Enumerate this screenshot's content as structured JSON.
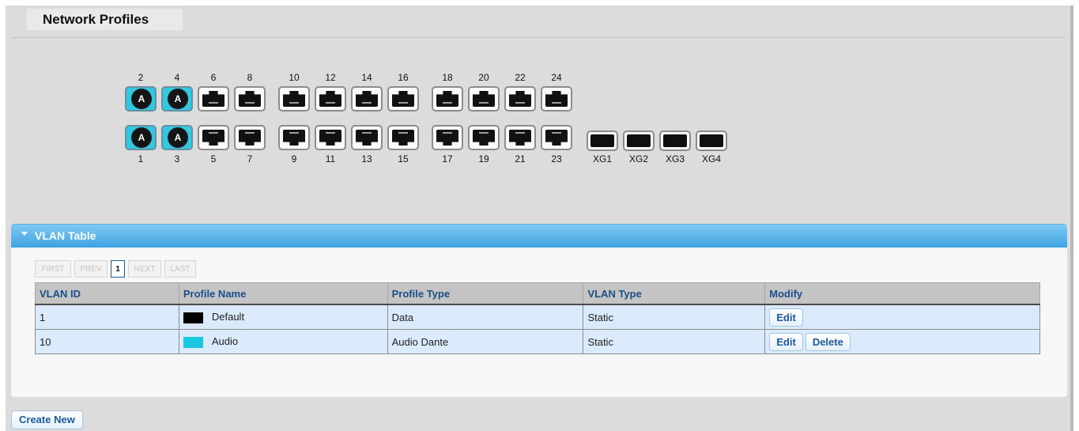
{
  "page": {
    "title": "Network Profiles"
  },
  "ports": {
    "top_labels": [
      "2",
      "4",
      "6",
      "8",
      "10",
      "12",
      "14",
      "16",
      "18",
      "20",
      "22",
      "24"
    ],
    "bottom_labels": [
      "1",
      "3",
      "5",
      "7",
      "9",
      "11",
      "13",
      "15",
      "17",
      "19",
      "21",
      "23"
    ],
    "sfp_labels": [
      "XG1",
      "XG2",
      "XG3",
      "XG4"
    ],
    "active_badge": "A",
    "active_ports": [
      "1",
      "2",
      "3",
      "4"
    ],
    "active_color": "#36c7e0"
  },
  "vlan_panel": {
    "title": "VLAN Table",
    "pager": {
      "first": "FIRST",
      "prev": "PREV",
      "current": "1",
      "next": "NEXT",
      "last": "LAST"
    },
    "columns": [
      "VLAN ID",
      "Profile Name",
      "Profile Type",
      "VLAN Type",
      "Modify"
    ],
    "rows": [
      {
        "vlan_id": "1",
        "profile_name": "Default",
        "color": "#000000",
        "profile_type": "Data",
        "vlan_type": "Static",
        "actions": [
          "Edit"
        ]
      },
      {
        "vlan_id": "10",
        "profile_name": "Audio",
        "color": "#18c8e0",
        "profile_type": "Audio Dante",
        "vlan_type": "Static",
        "actions": [
          "Edit",
          "Delete"
        ]
      }
    ]
  },
  "create_button": "Create New"
}
